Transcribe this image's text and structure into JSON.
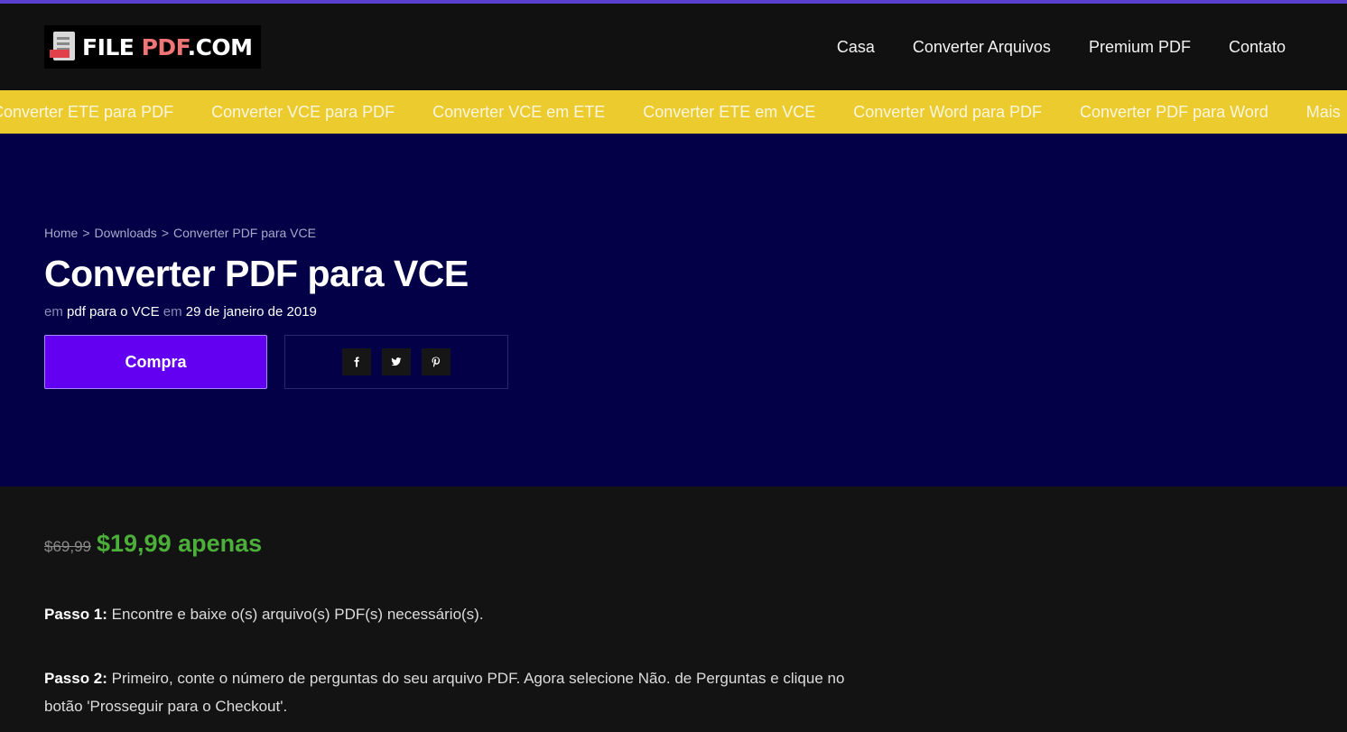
{
  "brand": {
    "logo_white": "FILE ",
    "logo_red": "PDF",
    "logo_white2": ".COM"
  },
  "nav": {
    "items": [
      "Casa",
      "Converter Arquivos",
      "Premium PDF",
      "Contato"
    ]
  },
  "ticker": {
    "items": [
      "Converter ETE para PDF",
      "Converter VCE para PDF",
      "Converter VCE em ETE",
      "Converter ETE em VCE",
      "Converter Word para PDF",
      "Converter PDF para Word",
      "Mais"
    ]
  },
  "breadcrumb": {
    "home": "Home",
    "sep": ">",
    "downloads": "Downloads",
    "current": "Converter PDF para VCE"
  },
  "hero": {
    "title": "Converter PDF para VCE",
    "meta_prefix": "em",
    "category": "pdf para o VCE",
    "meta_mid": "em",
    "date": "29 de janeiro de 2019",
    "buy_label": "Compra"
  },
  "share": {
    "icons": [
      "facebook-icon",
      "twitter-icon",
      "pinterest-icon"
    ]
  },
  "price": {
    "old": "$69,99",
    "new": "$19,99 apenas"
  },
  "steps": [
    {
      "label": "Passo 1:",
      "text": " Encontre e baixe o(s) arquivo(s) PDF(s) necessário(s)."
    },
    {
      "label": "Passo 2:",
      "text": " Primeiro, conte o número de perguntas do seu arquivo PDF. Agora selecione Não. de Perguntas e clique no botão 'Prosseguir para o Checkout'."
    }
  ],
  "colors": {
    "accent": "#6300f2",
    "hero_bg": "#030048",
    "ticker_bg": "#ebcb2e",
    "price_green": "#4caf3a"
  }
}
